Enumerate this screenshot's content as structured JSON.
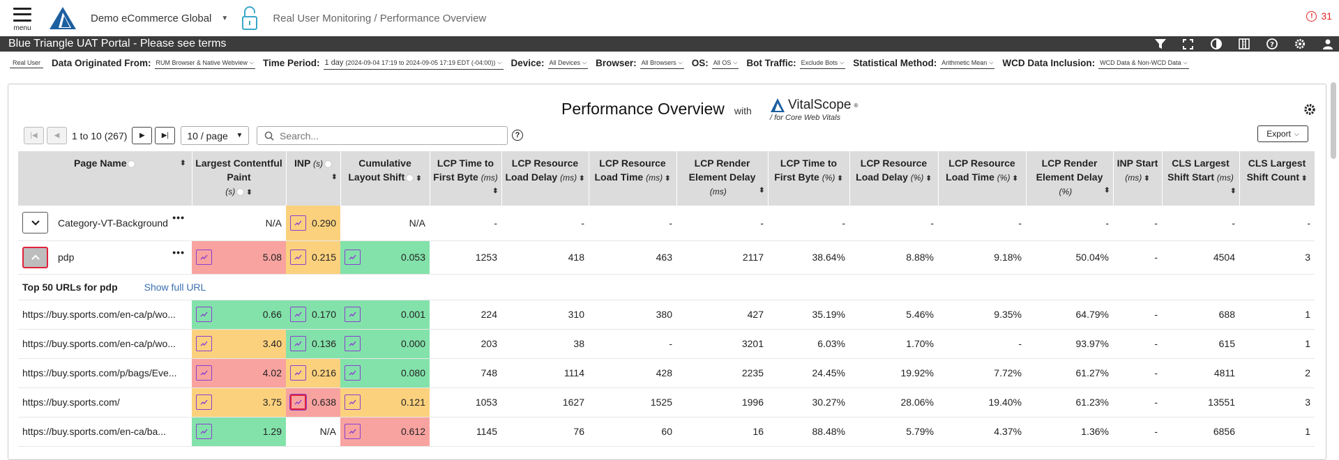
{
  "header": {
    "menu_label": "menu",
    "org_name": "Demo eCommerce Global",
    "breadcrumb": "Real User Monitoring / Performance Overview",
    "alert_count": "31"
  },
  "banner": {
    "title": "Blue Triangle UAT Portal - Please see terms"
  },
  "filters": {
    "mode": "Real User",
    "data_origin_label": "Data Originated From:",
    "data_origin_value": "RUM Browser & Native Webview",
    "time_label": "Time Period:",
    "time_value": "1 day",
    "time_detail": "(2024-09-04 17:19 to 2024-09-05 17:19 EDT (-04:00))",
    "device_label": "Device:",
    "device_value": "All Devices",
    "browser_label": "Browser:",
    "browser_value": "All Browsers",
    "os_label": "OS:",
    "os_value": "All OS",
    "bot_label": "Bot Traffic:",
    "bot_value": "Exclude Bots",
    "stat_label": "Statistical Method:",
    "stat_value": "Arithmetic Mean",
    "wcd_label": "WCD Data Inclusion:",
    "wcd_value": "WCD Data & Non-WCD Data"
  },
  "panel": {
    "title": "Performance Overview",
    "with": "with",
    "brand": "VitalScope",
    "brand_tm": "®",
    "brand_sub": "for Core Web Vitals",
    "range": "1 to 10 (267)",
    "per_page": "10 / page",
    "search_placeholder": "Search...",
    "export_label": "Export"
  },
  "columns": {
    "page_name": "Page Name",
    "lcp": "Largest Contentful Paint",
    "lcp_unit": "(s)",
    "inp": "INP",
    "inp_unit": "(s)",
    "cls": "Cumulative Layout Shift",
    "ttfb": "LCP Time to First Byte",
    "ttfb_unit": "(ms)",
    "rld": "LCP Resource Load Delay",
    "rld_unit": "(ms)",
    "rlt": "LCP Resource Load Time",
    "rlt_unit": "(ms)",
    "red": "LCP Render Element Delay",
    "red_unit": "(ms)",
    "ttfb_pct": "LCP Time to First Byte",
    "pct_unit": "(%)",
    "rld_pct": "LCP Resource Load Delay",
    "rlt_pct": "LCP Resource Load Time",
    "red_pct": "LCP Render Element Delay",
    "inp_start": "INP Start",
    "inp_start_unit": "(ms)",
    "cls_start": "CLS Largest Shift Start",
    "cls_start_unit": "(ms)",
    "cls_count": "CLS Largest Shift Count"
  },
  "rows": [
    {
      "name": "Category-VT-Background",
      "lcp": "N/A",
      "inp": "0.290",
      "cls": "N/A",
      "ttfb": "-",
      "rld": "-",
      "rlt": "-",
      "red": "-",
      "ttfb_pct": "-",
      "rld_pct": "-",
      "rlt_pct": "-",
      "red_pct": "-",
      "inp_start": "-",
      "cls_start": "-",
      "cls_count": "-"
    },
    {
      "name": "pdp",
      "lcp": "5.08",
      "inp": "0.215",
      "cls": "0.053",
      "ttfb": "1253",
      "rld": "418",
      "rlt": "463",
      "red": "2117",
      "ttfb_pct": "38.64%",
      "rld_pct": "8.88%",
      "rlt_pct": "9.18%",
      "red_pct": "50.04%",
      "inp_start": "-",
      "cls_start": "4504",
      "cls_count": "3"
    }
  ],
  "sub": {
    "title": "Top 50 URLs for pdp",
    "link": "Show full URL"
  },
  "urls": [
    {
      "name": "https://buy.sports.com/en-ca/p/wo...",
      "lcp": "0.66",
      "inp": "0.170",
      "cls": "0.001",
      "ttfb": "224",
      "rld": "310",
      "rlt": "380",
      "red": "427",
      "ttfb_pct": "35.19%",
      "rld_pct": "5.46%",
      "rlt_pct": "9.35%",
      "red_pct": "64.79%",
      "inp_start": "-",
      "cls_start": "688",
      "cls_count": "1"
    },
    {
      "name": "https://buy.sports.com/en-ca/p/wo...",
      "lcp": "3.40",
      "inp": "0.136",
      "cls": "0.000",
      "ttfb": "203",
      "rld": "38",
      "rlt": "-",
      "red": "3201",
      "ttfb_pct": "6.03%",
      "rld_pct": "1.70%",
      "rlt_pct": "-",
      "red_pct": "93.97%",
      "inp_start": "-",
      "cls_start": "615",
      "cls_count": "1"
    },
    {
      "name": "https://buy.sports.com/p/bags/Eve...",
      "lcp": "4.02",
      "inp": "0.216",
      "cls": "0.080",
      "ttfb": "748",
      "rld": "1114",
      "rlt": "428",
      "red": "2235",
      "ttfb_pct": "24.45%",
      "rld_pct": "19.92%",
      "rlt_pct": "7.72%",
      "red_pct": "61.27%",
      "inp_start": "-",
      "cls_start": "4811",
      "cls_count": "2"
    },
    {
      "name": "https://buy.sports.com/",
      "lcp": "3.75",
      "inp": "0.638",
      "cls": "0.121",
      "ttfb": "1053",
      "rld": "1627",
      "rlt": "1525",
      "red": "1996",
      "ttfb_pct": "30.27%",
      "rld_pct": "28.06%",
      "rlt_pct": "19.40%",
      "red_pct": "61.23%",
      "inp_start": "-",
      "cls_start": "13551",
      "cls_count": "3"
    },
    {
      "name": "https://buy.sports.com/en-ca/ba...",
      "lcp": "1.29",
      "inp": "N/A",
      "cls": "0.612",
      "ttfb": "1145",
      "rld": "76",
      "rlt": "60",
      "red": "16",
      "ttfb_pct": "88.48%",
      "rld_pct": "5.79%",
      "rlt_pct": "4.37%",
      "red_pct": "1.36%",
      "inp_start": "-",
      "cls_start": "6856",
      "cls_count": "1"
    }
  ],
  "colors": {
    "poor": "#f8a3a0",
    "needs_improvement": "#fcd17e",
    "good": "#83e2aa",
    "trend_border": "#8a3fcf",
    "brand_blue": "#1b5fa0"
  },
  "icons": [
    "menu-icon",
    "logo-icon",
    "unlock-icon",
    "alert-icon",
    "filter-icon",
    "fullscreen-icon",
    "contrast-icon",
    "columns-icon",
    "help-icon",
    "gear-icon",
    "user-icon",
    "trend-icon"
  ]
}
